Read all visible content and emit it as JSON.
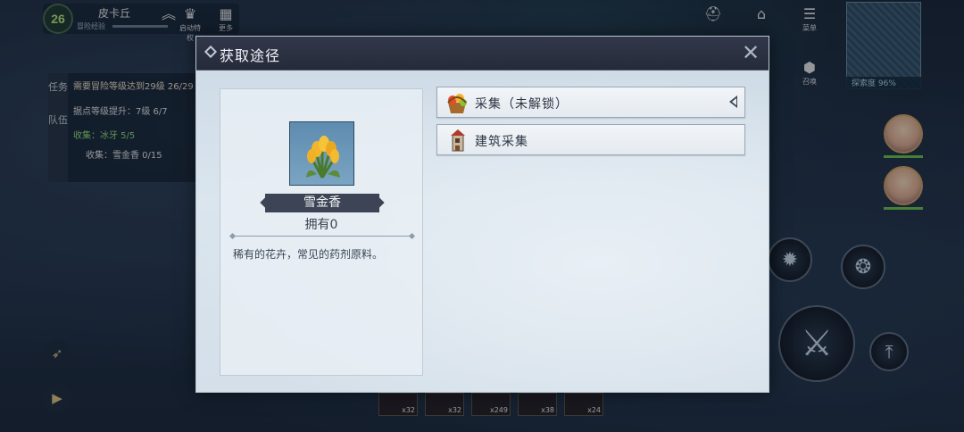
{
  "player": {
    "level": "26",
    "name": "皮卡丘",
    "exp_label": "冒险经验"
  },
  "top_icons": [
    {
      "label": "启动特权"
    },
    {
      "label": "更多"
    }
  ],
  "quest": {
    "tab_task": "任务",
    "tab_team": "队伍",
    "lines": [
      "需要冒险等级达到29级 26/29",
      "据点等级提升：7级 6/7",
      "收集：冰牙 5/5",
      "收集：雪金香 0/15"
    ]
  },
  "right_hud": {
    "menu_label": "菜单",
    "summon_label": "召唤",
    "explore_label": "探索度 96%"
  },
  "hotbar": {
    "counts": [
      "x32",
      "x32",
      "x249",
      "x38",
      "x24"
    ]
  },
  "modal": {
    "title": "获取途径",
    "item": {
      "name": "雪金香",
      "owned": "拥有0",
      "description": "稀有的花卉，常见的药剂原料。"
    },
    "sources": [
      {
        "label": "采集（未解锁）",
        "icon": "fruit-basket-icon"
      },
      {
        "label": "建筑采集",
        "icon": "building-tower-icon"
      }
    ]
  }
}
